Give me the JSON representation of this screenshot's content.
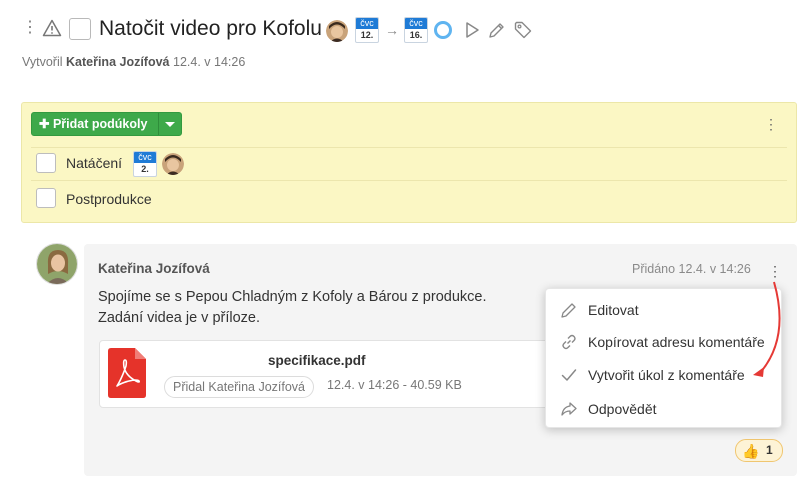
{
  "task": {
    "title": "Natočit video pro Kofolu",
    "start_month": "čvc",
    "start_day": "12.",
    "due_month": "čvc",
    "due_day": "16.",
    "arrow": "→",
    "created_prefix": "Vytvořil",
    "created_by": "Kateřina Jozífová",
    "created_when": "12.4. v 14:26"
  },
  "subtasks": {
    "add_label": "Přidat podúkoly",
    "items": [
      {
        "label": "Natáčení",
        "month": "čvc",
        "day": "2."
      },
      {
        "label": "Postprodukce"
      }
    ]
  },
  "comment": {
    "author": "Kateřina Jozífová",
    "added": "Přidáno 12.4. v 14:26",
    "line1": "Spojíme se s Pepou Chladným z Kofoly a Bárou z produkce.",
    "line2": "Zadání videa je v příloze.",
    "attachment": {
      "name": "specifikace.pdf",
      "added_by": "Přidal Kateřina Jozífová",
      "info": "12.4. v 14:26 - 40.59 KB"
    },
    "likes": "1"
  },
  "menu": {
    "items": [
      {
        "label": "Editovat",
        "icon": "pencil-icon"
      },
      {
        "label": "Kopírovat adresu komentáře",
        "icon": "link-icon"
      },
      {
        "label": "Vytvořit úkol z komentáře",
        "icon": "check-icon"
      },
      {
        "label": "Odpovědět",
        "icon": "reply-icon"
      }
    ]
  },
  "colors": {
    "accent_green": "#3ea94a",
    "panel_yellow": "#fbf7c4",
    "calendar_blue": "#1f7bd6",
    "annotation_red": "#e53935"
  }
}
